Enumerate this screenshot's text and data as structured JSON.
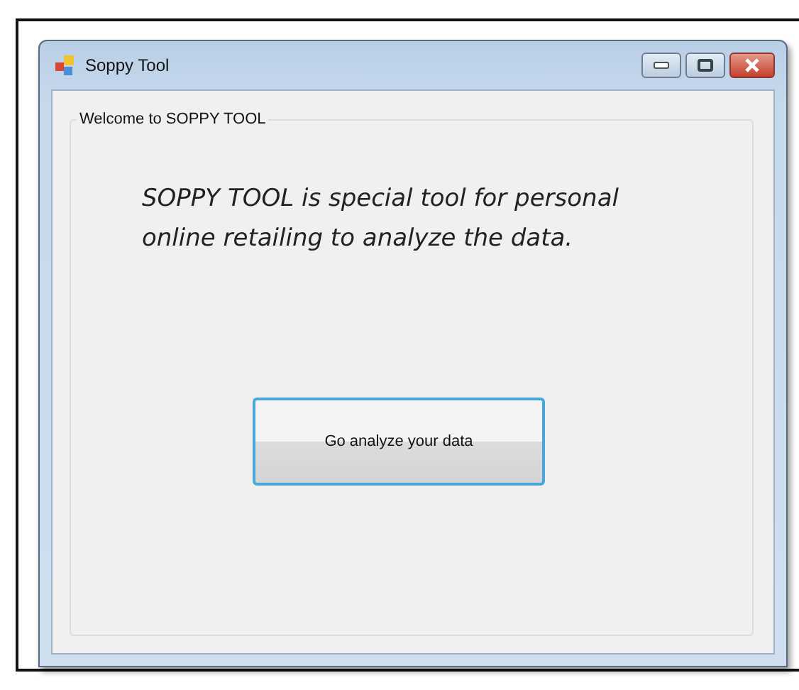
{
  "window": {
    "title": "Soppy Tool"
  },
  "group": {
    "title": "Welcome to SOPPY TOOL"
  },
  "description": "SOPPY TOOL is special tool for personal online retailing to analyze the data.",
  "button": {
    "label": "Go analyze your data"
  }
}
